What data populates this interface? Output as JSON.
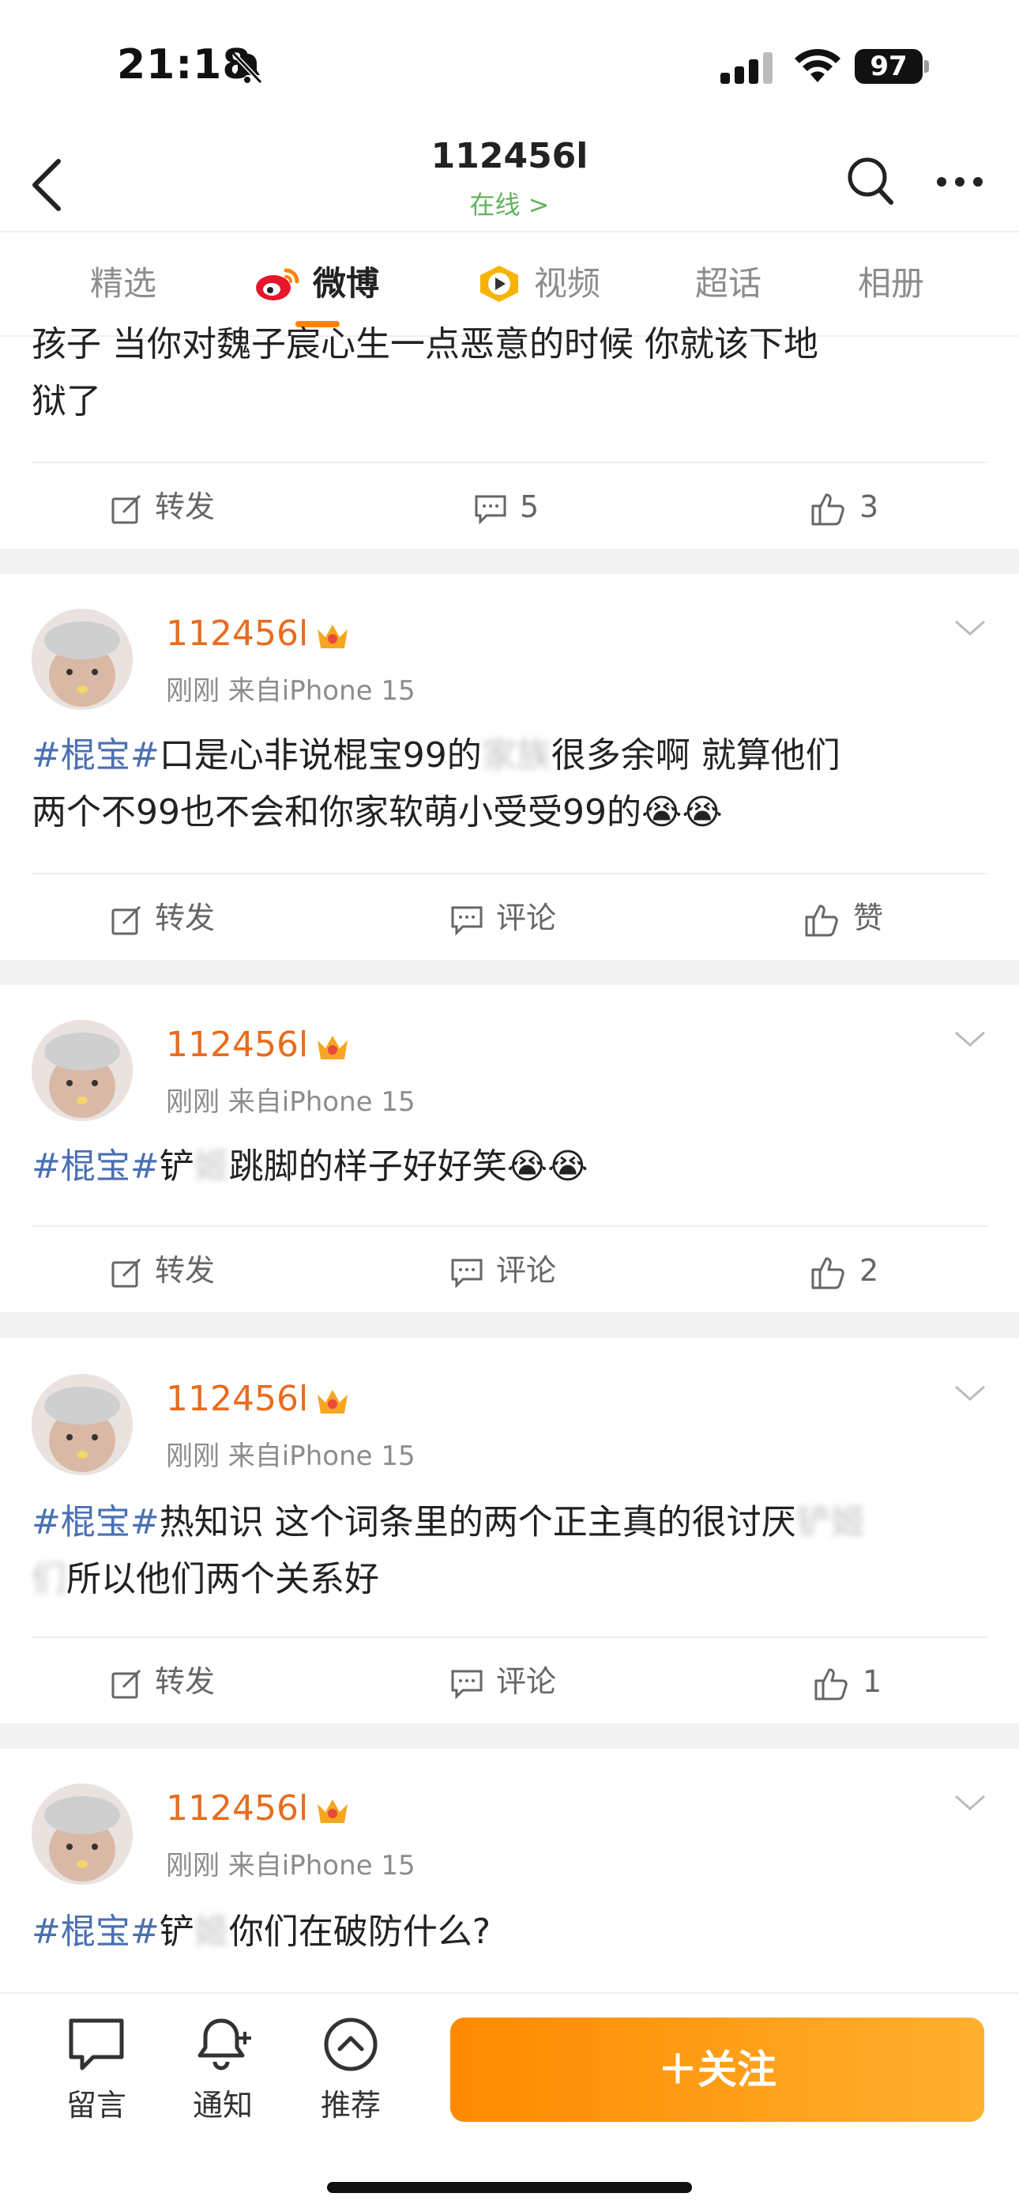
{
  "status": {
    "time": "21:18",
    "battery": "97"
  },
  "header": {
    "title": "112456l",
    "subtitle": "在线 >"
  },
  "tabs": [
    {
      "label": "精选"
    },
    {
      "label": "微博"
    },
    {
      "label": "视频"
    },
    {
      "label": "超话"
    },
    {
      "label": "相册"
    }
  ],
  "partial_post": {
    "text_line1": "孩子 当你对魏子宸心生一点恶意的时候 你就该下地",
    "text_line2": "狱了",
    "repost": "转发",
    "comments": "5",
    "likes": "3"
  },
  "posts": [
    {
      "username": "112456l",
      "meta": "刚刚  来自iPhone 15",
      "topic": "#棍宝#",
      "text_a": "口是心非说棍宝99的",
      "blur": "家族",
      "text_b": "很多余啊 就算他们",
      "line2": "两个不99也不会和你家软萌小受受99的😭😭",
      "repost": "转发",
      "comment": "评论",
      "like": "赞"
    },
    {
      "username": "112456l",
      "meta": "刚刚  来自iPhone 15",
      "topic": "#棍宝#",
      "text_a": "铲",
      "blur": "姬",
      "text_b": "跳脚的样子好好笑😭😭",
      "repost": "转发",
      "comment": "评论",
      "like": "2"
    },
    {
      "username": "112456l",
      "meta": "刚刚  来自iPhone 15",
      "topic": "#棍宝#",
      "text_a": "热知识 这个词条里的两个正主真的很讨厌",
      "blur": "铲姬",
      "line2_blur": "们",
      "line2": "所以他们两个关系好",
      "repost": "转发",
      "comment": "评论",
      "like": "1"
    },
    {
      "username": "112456l",
      "meta": "刚刚  来自iPhone 15",
      "topic": "#棍宝#",
      "text_a": "铲",
      "blur": "姬",
      "text_b": "你们在破防什么?"
    }
  ],
  "bottom_bar": {
    "message": "留言",
    "notify": "通知",
    "recommend": "推荐",
    "follow": "＋关注"
  },
  "colors": {
    "accent": "#ff8200",
    "username": "#e86c1e",
    "topic": "#4a6fb3",
    "online": "#63b35e"
  }
}
